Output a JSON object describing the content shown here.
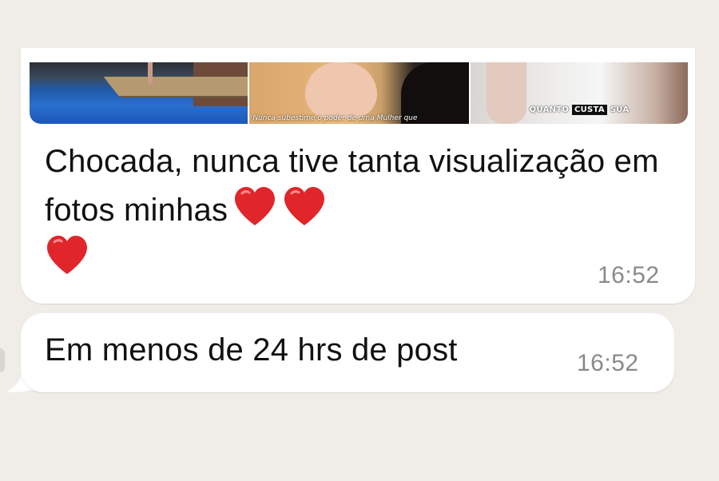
{
  "messages": [
    {
      "text": "Chocada, nunca tive tanta visualização em fotos minhas",
      "emoji": [
        "heart-icon",
        "heart-icon",
        "heart-icon"
      ],
      "time": "16:52",
      "preview": {
        "thumb2_caption": "Nunca subestime o poder de uma Mulher que",
        "thumb3_caption_a": "QUANTO",
        "thumb3_caption_b": "CUSTA",
        "thumb3_caption_c": "SUA"
      }
    },
    {
      "text": "Em menos de 24 hrs de post",
      "time": "16:52"
    }
  ],
  "colors": {
    "background": "#f0ede8",
    "bubble": "#ffffff",
    "text": "#111111",
    "timestamp": "#8a8a8a",
    "heart": "#e0262b"
  }
}
